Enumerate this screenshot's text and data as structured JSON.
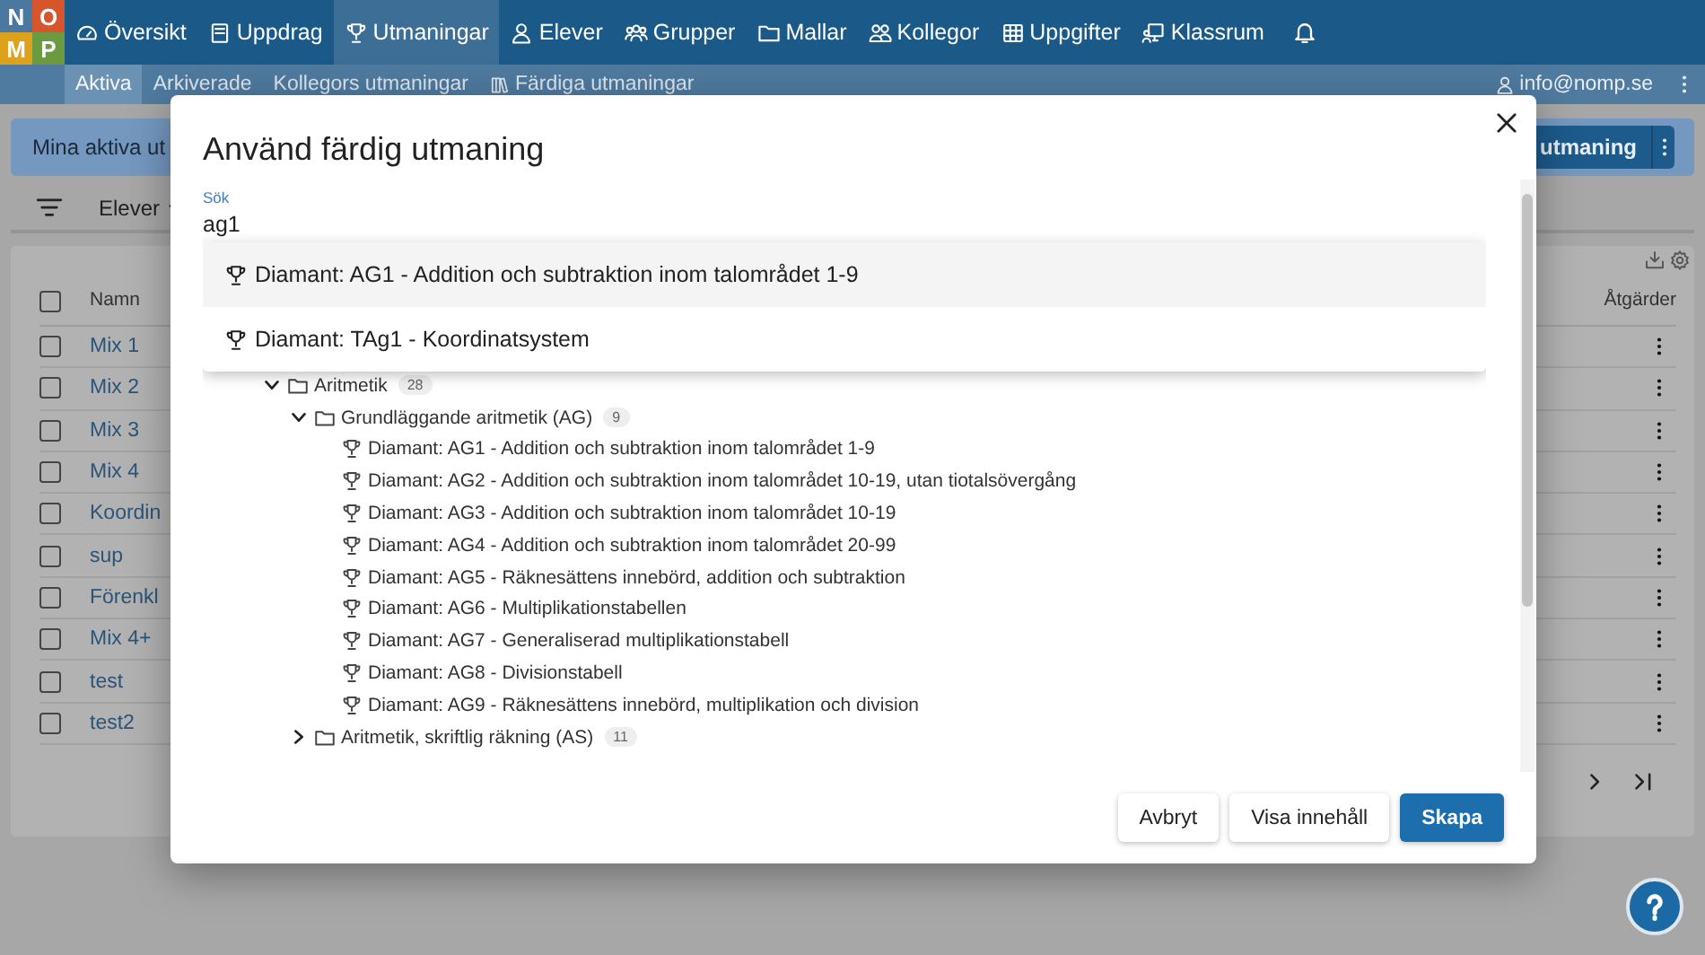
{
  "nav": {
    "logo": [
      {
        "letter": "N",
        "color": "#4a78a0"
      },
      {
        "letter": "O",
        "color": "#d6552d"
      },
      {
        "letter": "M",
        "color": "#dea11c"
      },
      {
        "letter": "P",
        "color": "#6b9a40"
      }
    ],
    "items": [
      {
        "label": "Översikt",
        "selected": false
      },
      {
        "label": "Uppdrag",
        "selected": false
      },
      {
        "label": "Utmaningar",
        "selected": true
      },
      {
        "label": "Elever",
        "selected": false
      },
      {
        "label": "Grupper",
        "selected": false
      },
      {
        "label": "Mallar",
        "selected": false
      },
      {
        "label": "Kollegor",
        "selected": false
      },
      {
        "label": "Uppgifter",
        "selected": false
      },
      {
        "label": "Klassrum",
        "selected": false
      }
    ]
  },
  "subnav": {
    "tabs": [
      {
        "label": "Aktiva",
        "selected": true
      },
      {
        "label": "Arkiverade",
        "selected": false
      },
      {
        "label": "Kollegors utmaningar",
        "selected": false
      },
      {
        "label": "Färdiga utmaningar",
        "selected": false
      }
    ],
    "user": "info@nomp.se"
  },
  "banner": {
    "title": "Mina aktiva ut",
    "button": "utmaning"
  },
  "filter": {
    "label": "Elever"
  },
  "table": {
    "all_checked": false,
    "columns": [
      "Namn",
      "Åtgärder"
    ],
    "rows": [
      {
        "name": "Mix 1",
        "checked": false
      },
      {
        "name": "Mix 2",
        "checked": false
      },
      {
        "name": "Mix 3",
        "checked": false
      },
      {
        "name": "Mix 4",
        "checked": false
      },
      {
        "name": "Koordin",
        "checked": false
      },
      {
        "name": "sup",
        "checked": false
      },
      {
        "name": "Förenkl",
        "checked": false
      },
      {
        "name": "Mix 4+",
        "checked": false
      },
      {
        "name": "test",
        "checked": false
      },
      {
        "name": "test2",
        "checked": false
      }
    ]
  },
  "dialog": {
    "title": "Använd färdig utmaning",
    "search": {
      "label": "Sök",
      "value": "ag1"
    },
    "suggestions": [
      {
        "label": "Diamant: AG1 - Addition och subtraktion inom talområdet 1-9",
        "selected": true
      },
      {
        "label": "Diamant: TAg1 - Koordinatsystem",
        "selected": false
      }
    ],
    "tree": [
      {
        "kind": "folder",
        "label": "Aritmetik",
        "count": "28",
        "expanded": true,
        "children": [
          {
            "kind": "folder",
            "label": "Grundläggande aritmetik (AG)",
            "count": "9",
            "expanded": true,
            "children": [
              {
                "kind": "challenge",
                "label": "Diamant: AG1 - Addition och subtraktion inom talområdet 1-9"
              },
              {
                "kind": "challenge",
                "label": "Diamant: AG2 - Addition och subtraktion inom talområdet 10-19, utan tiotalsövergång"
              },
              {
                "kind": "challenge",
                "label": "Diamant: AG3 - Addition och subtraktion inom talområdet 10-19"
              },
              {
                "kind": "challenge",
                "label": "Diamant: AG4 - Addition och subtraktion inom talområdet 20-99"
              },
              {
                "kind": "challenge",
                "label": "Diamant: AG5 - Räknesättens innebörd, addition och subtraktion"
              },
              {
                "kind": "challenge",
                "label": "Diamant: AG6 - Multiplikationstabellen"
              },
              {
                "kind": "challenge",
                "label": "Diamant: AG7 - Generaliserad multiplikationstabell"
              },
              {
                "kind": "challenge",
                "label": "Diamant: AG8 - Divisionstabell"
              },
              {
                "kind": "challenge",
                "label": "Diamant: AG9 - Räknesättens innebörd, multiplikation och division"
              }
            ]
          },
          {
            "kind": "folder",
            "label": "Aritmetik, skriftlig räkning (AS)",
            "count": "11",
            "expanded": false
          }
        ]
      }
    ],
    "buttons": [
      {
        "label": "Avbryt",
        "kind": "secondary"
      },
      {
        "label": "Visa innehåll",
        "kind": "secondary"
      },
      {
        "label": "Skapa",
        "kind": "primary"
      }
    ]
  }
}
